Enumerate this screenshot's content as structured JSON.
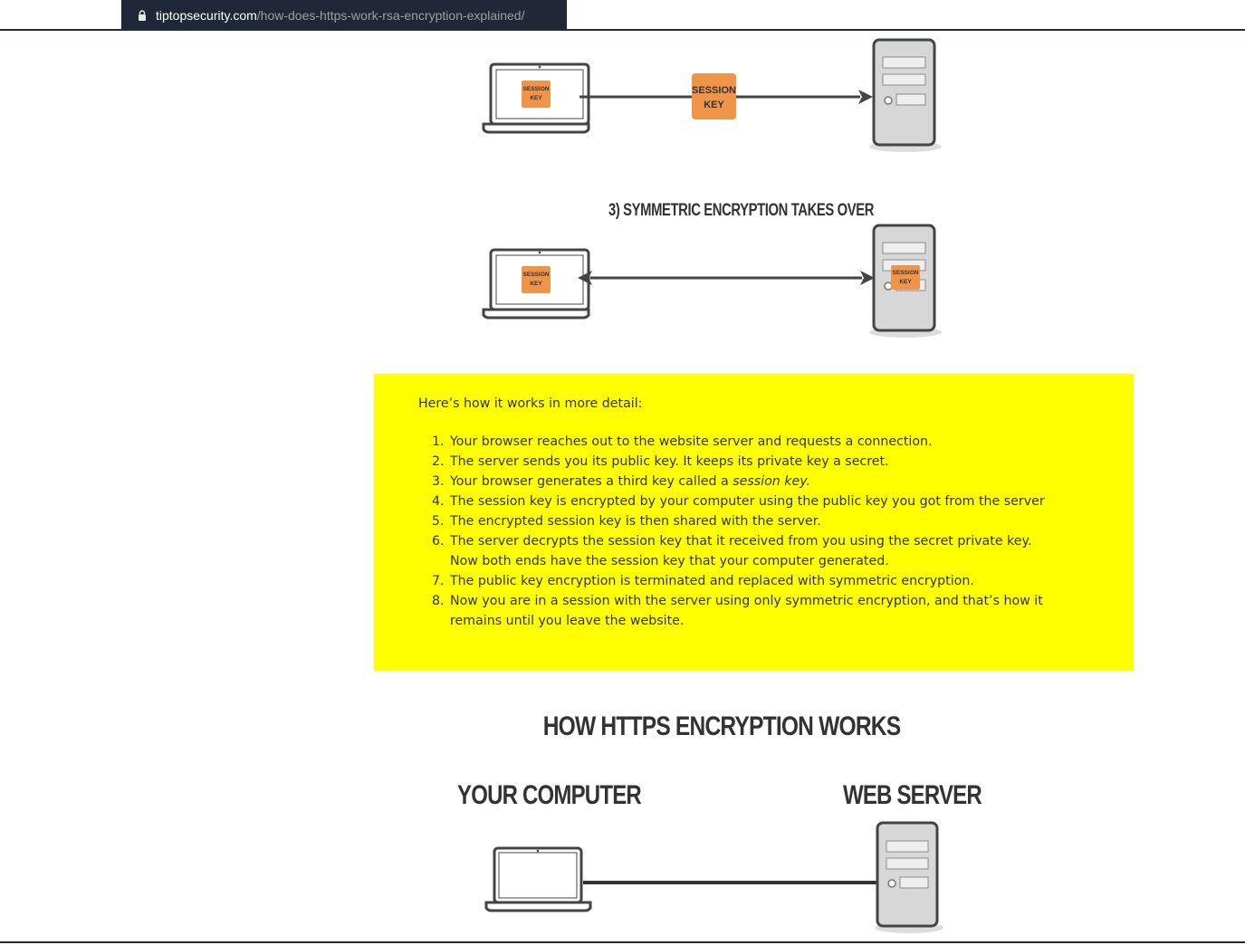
{
  "browser": {
    "url_domain": "tiptopsecurity.com",
    "url_path": "/how-does-https-work-rsa-encryption-explained/"
  },
  "diagram_top": {
    "laptop_badge": "SESSION KEY",
    "transit_badge": "SESSION KEY"
  },
  "diagram_symmetric": {
    "caption": "3) SYMMETRIC ENCRYPTION TAKES OVER",
    "laptop_badge": "SESSION KEY",
    "server_badge": "SESSION KEY"
  },
  "note": {
    "intro": "Here’s how it works in more detail:",
    "steps": [
      "Your browser reaches out to the website server and requests a connection.",
      "The server sends you its public key. It keeps its private key a secret.",
      "Your browser generates a third key called a",
      "The session key is encrypted by your computer using the public key you got from the server",
      "The encrypted session key is then shared with the server.",
      "The server decrypts the session key that it received from you using the secret private key. Now both ends have the session key that your computer generated.",
      "The public key encryption is terminated and replaced with symmetric encryption.",
      "Now you are in a session with the server using only symmetric encryption, and that’s how it remains until you leave the website."
    ],
    "step3_emphasis": "session key."
  },
  "diagram_https": {
    "title": "HOW HTTPS ENCRYPTION WORKS",
    "left_label": "YOUR COMPUTER",
    "right_label": "WEB SERVER"
  },
  "colors": {
    "note_background": "#ffff00",
    "badge_orange": "#f0944a",
    "urlbar_background": "#202837"
  }
}
